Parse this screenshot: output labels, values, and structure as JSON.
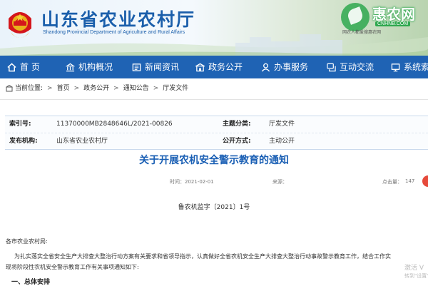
{
  "header": {
    "title": "山东省农业农村厅",
    "subtitle": "Shandong Provincial Department of Agriculture and Rural Affairs"
  },
  "watermark": {
    "brand": "惠农网",
    "domain": "CNHNB.COM",
    "tagline": "网农人都爱搜惠农网",
    "overlay_line1": "激活 V",
    "overlay_line2": "转到\"设置\""
  },
  "nav": {
    "items": [
      {
        "label": "首 页",
        "icon": "home-icon"
      },
      {
        "label": "机构概况",
        "icon": "institution-icon"
      },
      {
        "label": "新闻资讯",
        "icon": "news-icon"
      },
      {
        "label": "政务公开",
        "icon": "gov-affairs-icon"
      },
      {
        "label": "办事服务",
        "icon": "service-icon"
      },
      {
        "label": "互动交流",
        "icon": "interaction-icon"
      },
      {
        "label": "系统索",
        "icon": "system-icon"
      }
    ]
  },
  "breadcrumb": {
    "label": "当前位置:",
    "items": [
      "首页",
      "政务公开",
      "通知公告",
      "厅发文件"
    ]
  },
  "info_table": {
    "row1": {
      "k1": "索引号:",
      "v1": "11370000MB2848646L/2021-00826",
      "k2": "主题分类:",
      "v2": "厅发文件"
    },
    "row2": {
      "k1": "发布机构:",
      "v1": "山东省农业农村厅",
      "k2": "公开方式:",
      "v2": "主动公开"
    }
  },
  "article": {
    "title": "关于开展农机安全警示教育的通知",
    "date": "时间：2021-02-01",
    "source": "来源：",
    "views_label": "点击量：",
    "views": "147",
    "doc_number": "鲁农机监字〔2021〕1号",
    "recipient": "各市农业农村局:",
    "body_line1": "为扎实落实全省安全生产大排查大整治行动方案有关要求和省领导指示，认真做好全省农机安全生产大排查大整治行动事故警示教育工作，结合工作实",
    "body_line2": "现将阶段性农机安全警示教育工作有关事项通知如下:",
    "section1": "一、总体安排"
  },
  "colors": {
    "nav_bg": "#1f63b4",
    "title_blue": "#1a5fb4",
    "badge_red": "#e64a3b"
  }
}
